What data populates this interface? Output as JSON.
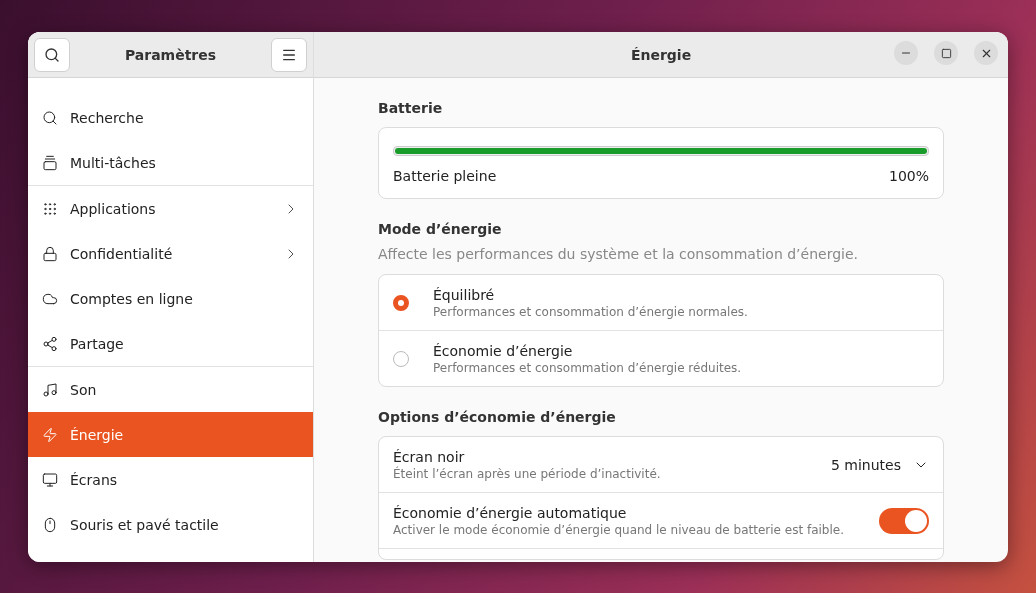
{
  "sidebar": {
    "title": "Paramètres",
    "groups": [
      [
        {
          "label": "Recherche",
          "chevron": false,
          "selected": false
        },
        {
          "label": "Multi-tâches",
          "chevron": false,
          "selected": false
        }
      ],
      [
        {
          "label": "Applications",
          "chevron": true,
          "selected": false
        },
        {
          "label": "Confidentialité",
          "chevron": true,
          "selected": false
        },
        {
          "label": "Comptes en ligne",
          "chevron": false,
          "selected": false
        },
        {
          "label": "Partage",
          "chevron": false,
          "selected": false
        }
      ],
      [
        {
          "label": "Son",
          "chevron": false,
          "selected": false
        },
        {
          "label": "Énergie",
          "chevron": false,
          "selected": true
        },
        {
          "label": "Écrans",
          "chevron": false,
          "selected": false
        },
        {
          "label": "Souris et pavé tactile",
          "chevron": false,
          "selected": false
        }
      ]
    ]
  },
  "window": {
    "title": "Énergie"
  },
  "battery": {
    "heading": "Batterie",
    "level": 1,
    "status": "Batterie pleine",
    "percent": "100%"
  },
  "mode": {
    "heading": "Mode d’énergie",
    "description": "Affecte les performances du système et la consommation d’énergie.",
    "options": [
      {
        "title": "Équilibré",
        "subtitle": "Performances et consommation d’énergie normales.",
        "selected": true
      },
      {
        "title": "Économie d’énergie",
        "subtitle": "Performances et consommation d’énergie réduites.",
        "selected": false
      }
    ]
  },
  "options": {
    "heading": "Options d’économie d’énergie",
    "rows": [
      {
        "kind": "dropdown",
        "title": "Écran noir",
        "subtitle": "Éteint l’écran après une période d’inactivité.",
        "value": "5 minutes"
      },
      {
        "kind": "switch",
        "title": "Économie d’énergie automatique",
        "subtitle": "Activer le mode économie d’énergie quand le niveau de batterie est faible.",
        "on": true
      }
    ]
  }
}
